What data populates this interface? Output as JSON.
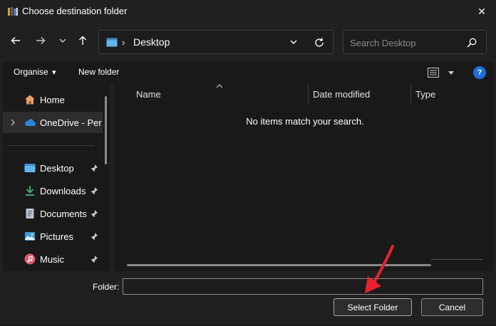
{
  "window": {
    "title": "Choose destination folder",
    "close_glyph": "✕"
  },
  "nav": {
    "back_icon": "arrow-left-icon",
    "forward_icon": "arrow-right-icon",
    "recent_icon": "chevron-down-icon",
    "up_icon": "arrow-up-icon",
    "address": {
      "location": "Desktop",
      "separator": "›"
    },
    "search": {
      "placeholder": "Search Desktop"
    }
  },
  "toolbar": {
    "organise_label": "Organise",
    "organise_caret": "▾",
    "new_folder_label": "New folder",
    "help_glyph": "?"
  },
  "sidebar": {
    "items": [
      {
        "label": "Home",
        "icon": "home-icon",
        "pinned": false
      },
      {
        "label": "OneDrive - Per",
        "icon": "onedrive-cloud-icon",
        "pinned": false,
        "selected": true,
        "expandable": true
      },
      {
        "label": "Desktop",
        "icon": "desktop-folder-icon",
        "pinned": true
      },
      {
        "label": "Downloads",
        "icon": "download-arrow-icon",
        "pinned": true
      },
      {
        "label": "Documents",
        "icon": "document-icon",
        "pinned": true
      },
      {
        "label": "Pictures",
        "icon": "pictures-icon",
        "pinned": true
      },
      {
        "label": "Music",
        "icon": "music-icon",
        "pinned": true
      }
    ]
  },
  "content": {
    "columns": [
      "Name",
      "Date modified",
      "Type"
    ],
    "empty_message": "No items match your search."
  },
  "footer": {
    "folder_label": "Folder:",
    "folder_value": "",
    "select_button": "Select Folder",
    "cancel_button": "Cancel"
  },
  "colors": {
    "background": "#202020",
    "panel": "#191919",
    "accent_blue": "#1e6fd9",
    "annotation_red": "#e8232a"
  }
}
